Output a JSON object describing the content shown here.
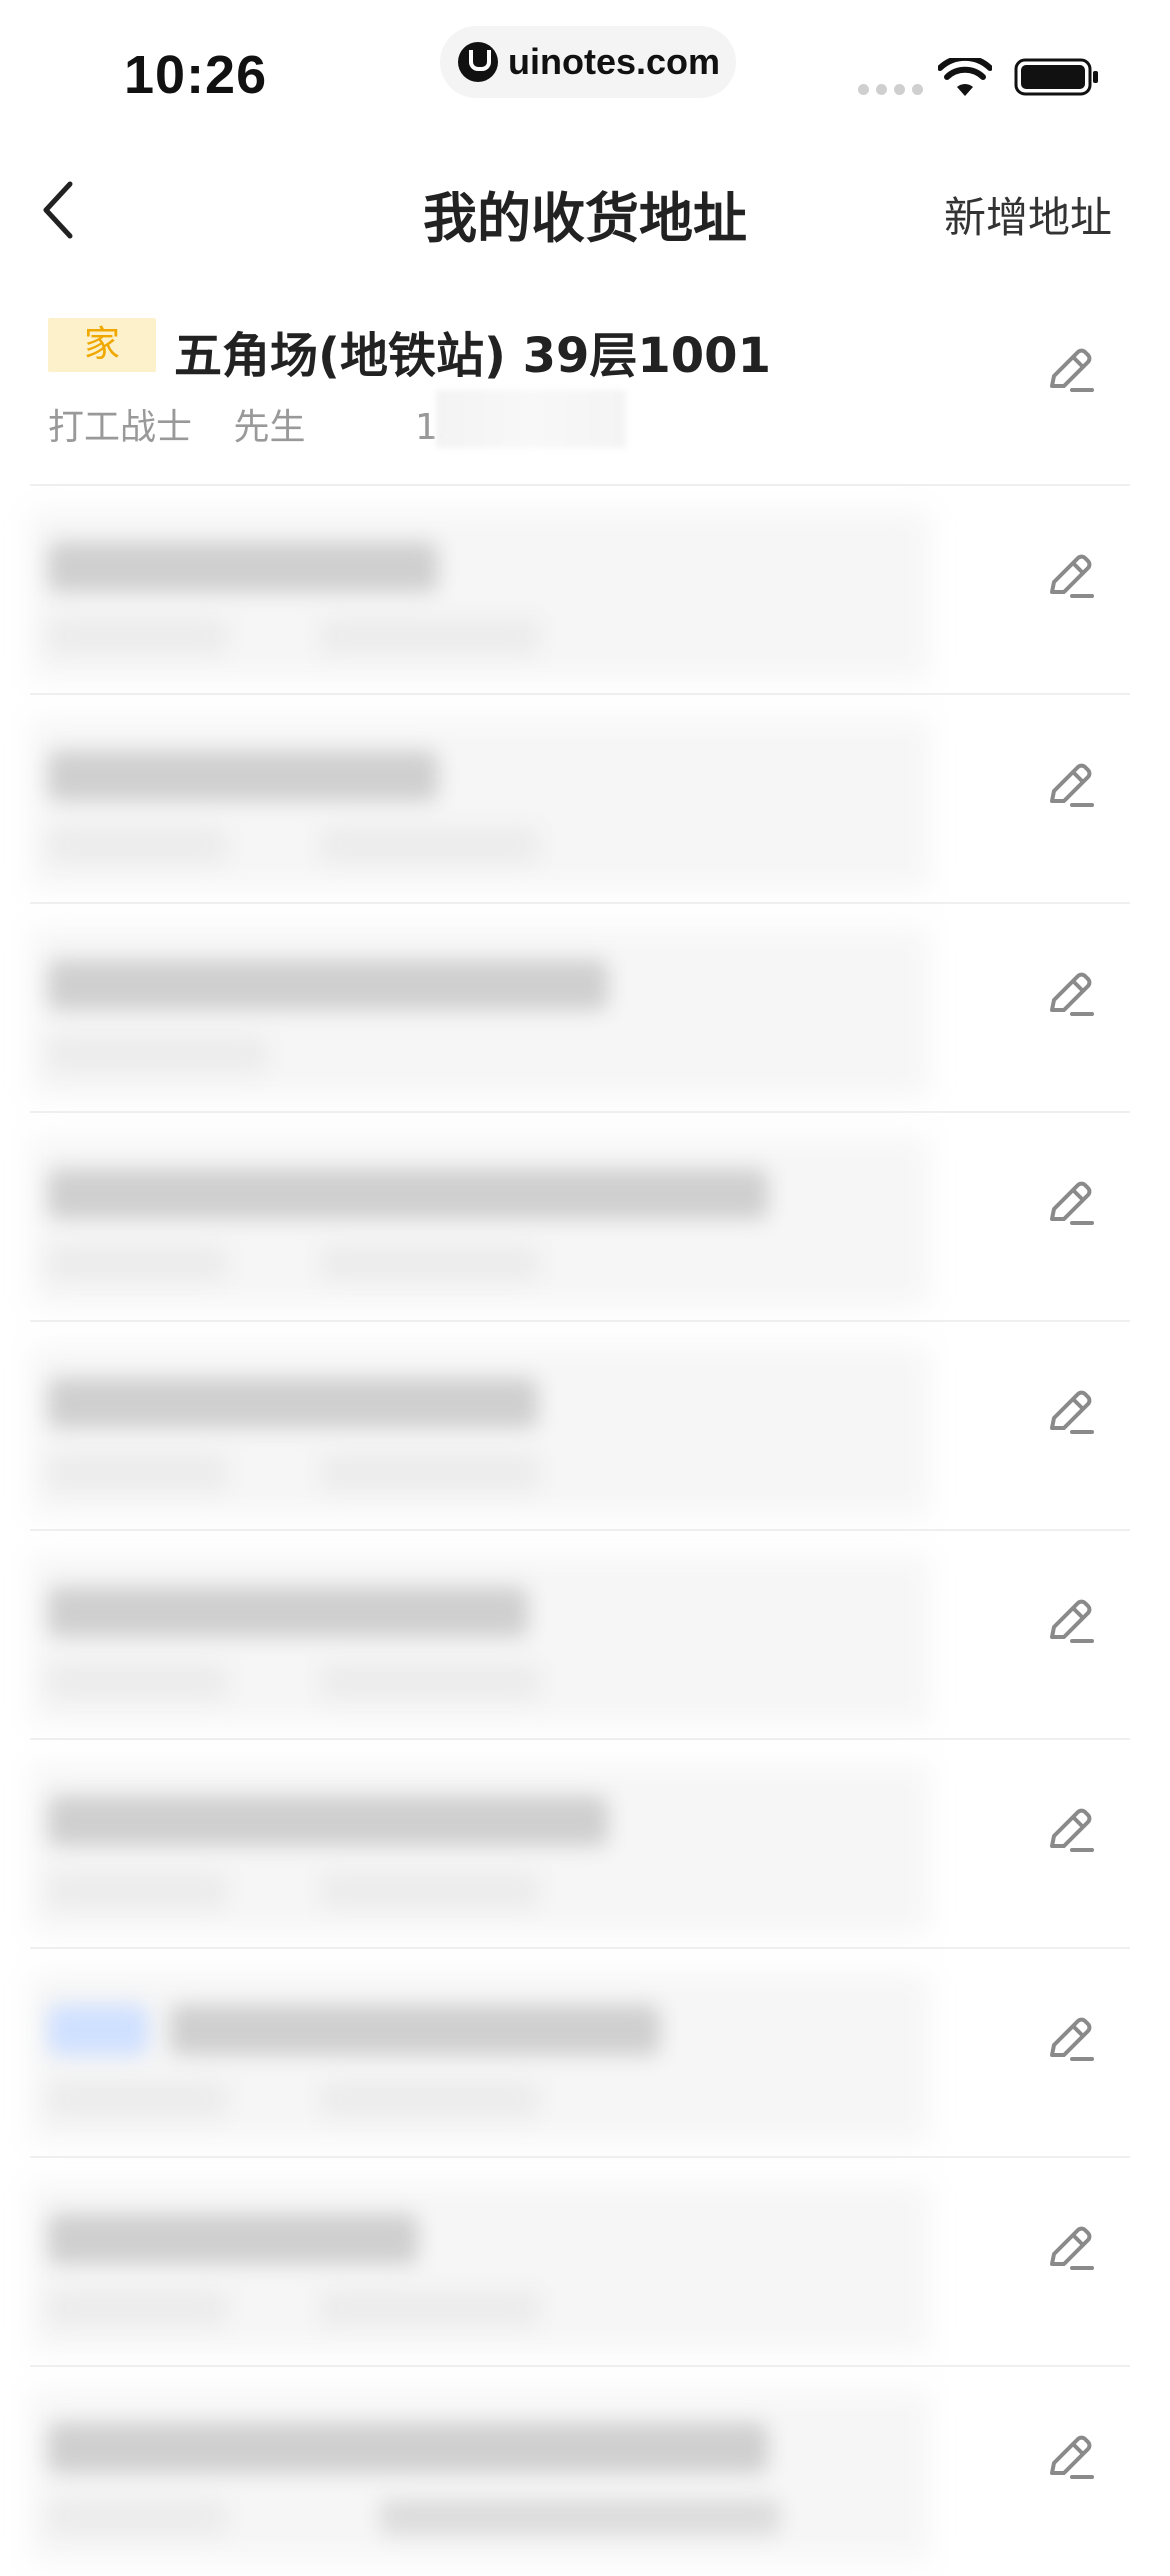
{
  "status_bar": {
    "time": "10:26",
    "url": "uinotes.com",
    "icons": [
      "signal-icon",
      "wifi-icon",
      "battery-icon"
    ]
  },
  "nav": {
    "back_icon": "chevron-left-icon",
    "title": "我的收货地址",
    "add_label": "新增地址"
  },
  "addresses": [
    {
      "tag": "家",
      "address": "五角场(地铁站) 39层1001",
      "name": "打工战士",
      "title": "先生",
      "phone": "15",
      "redacted": false
    },
    {
      "redacted": true
    },
    {
      "redacted": true
    },
    {
      "redacted": true
    },
    {
      "redacted": true
    },
    {
      "redacted": true
    },
    {
      "redacted": true
    },
    {
      "redacted": true
    },
    {
      "redacted": true
    },
    {
      "redacted": true
    },
    {
      "redacted": true
    }
  ],
  "colors": {
    "tag_bg": "#fdf1cc",
    "tag_text": "#f0a800",
    "secondary_text": "#999999",
    "icon": "#8a8a8a"
  }
}
